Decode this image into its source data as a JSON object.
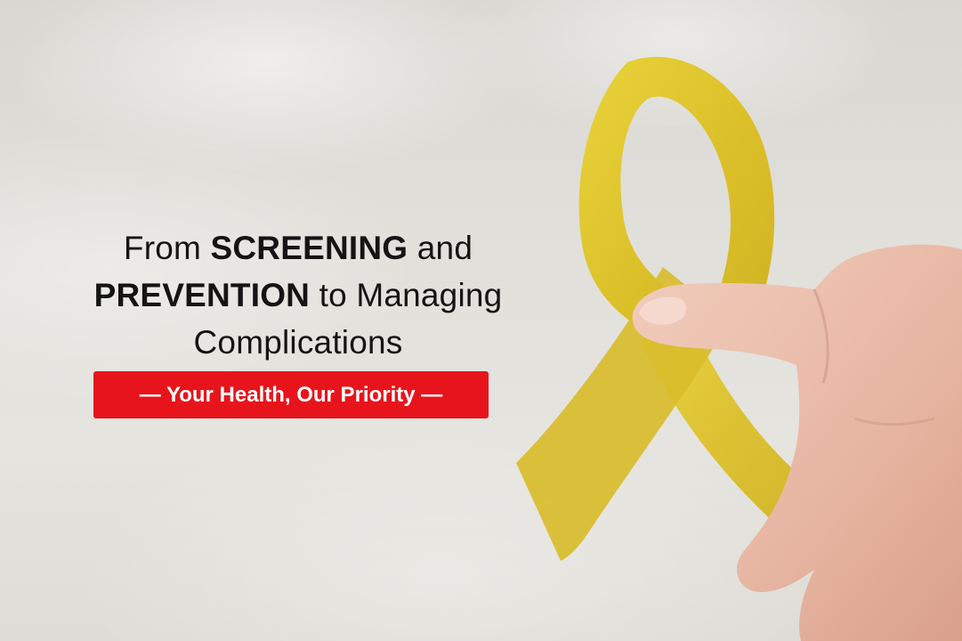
{
  "headline": {
    "line1": {
      "pre": "From ",
      "bold": "SCREENING",
      "post": " and"
    },
    "line2": {
      "pre": "",
      "bold": "PREVENTION",
      "post": " to Managing"
    },
    "line3": {
      "text": "Complications"
    }
  },
  "tagline": {
    "text": "— Your Health, Our Priority —"
  },
  "colors": {
    "accent": "#e8141c",
    "ribbon": "#e2c62c",
    "text": "#141414"
  },
  "icons": [
    "awareness-ribbon-icon",
    "hand-icon"
  ]
}
